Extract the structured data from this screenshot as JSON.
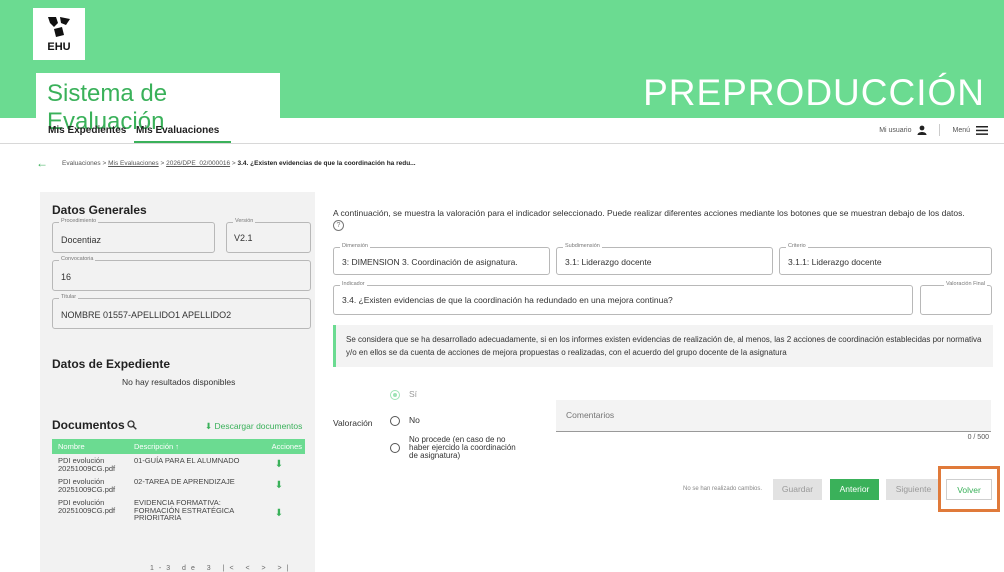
{
  "brand": {
    "logo_text": "EHU",
    "app_title": "Sistema de Evaluación",
    "environment": "PREPRODUCCIÓN"
  },
  "nav": {
    "tabs": [
      {
        "label": "Mis Expedientes"
      },
      {
        "label": "Mis Evaluaciones"
      }
    ],
    "user_label": "Mi usuario",
    "menu_label": "Menú"
  },
  "breadcrumb": {
    "root": "Evaluaciones",
    "separator": ">",
    "link1": "Mis Evaluaciones",
    "link2": "2026/DPE_02/000016",
    "current": "3.4. ¿Existen evidencias de que la coordinación ha redu..."
  },
  "general": {
    "title": "Datos Generales",
    "procedimiento": {
      "label": "Procedimiento",
      "value": "Docentiaz"
    },
    "version": {
      "label": "Versión",
      "value": "V2.1"
    },
    "convocatoria": {
      "label": "Convocatoria",
      "value": "16"
    },
    "titular": {
      "label": "Titular",
      "value": "NOMBRE 01557-APELLIDO1 APELLIDO2"
    }
  },
  "expediente": {
    "title": "Datos de Expediente",
    "empty_text": "No hay resultados disponibles"
  },
  "documents": {
    "title": "Documentos",
    "download_all": "Descargar documentos",
    "columns": [
      "Nombre",
      "Descripción ↑",
      "Acciones"
    ],
    "rows": [
      {
        "name": "PDI evolución 20251009CG.pdf",
        "description": "01-GUÍA PARA EL ALUMNADO"
      },
      {
        "name": "PDI evolución 20251009CG.pdf",
        "description": "02-TAREA DE APRENDIZAJE"
      },
      {
        "name": "PDI evolución 20251009CG.pdf",
        "description": "EVIDENCIA FORMATIVA: FORMACIÓN ESTRATÉGICA PRIORITARIA"
      }
    ],
    "pager": "1-3 de 3  |<  <  >  >|"
  },
  "intro_text": "A continuación, se muestra la valoración para el indicador seleccionado. Puede realizar diferentes acciones mediante los botones que se muestran debajo de los datos.",
  "indicator": {
    "dimension": {
      "label": "Dimensión",
      "value": "3: DIMENSION 3. Coordinación de asignatura."
    },
    "subdimension": {
      "label": "Subdimensión",
      "value": "3.1: Liderazgo docente"
    },
    "criterio": {
      "label": "Criterio",
      "value": "3.1.1: Liderazgo docente"
    },
    "indicador": {
      "label": "Indicador",
      "value": "3.4. ¿Existen evidencias de que la coordinación ha redundado en una mejora continua?"
    },
    "valoracion_final": {
      "label": "Valoración Final",
      "value": ""
    }
  },
  "callout_text": "Se considera que se ha desarrollado adecuadamente, si en los informes existen evidencias de realización de, al menos, las 2 acciones de coordinación establecidas por normativa y/o en ellos se da cuenta de acciones de mejora propuestas o realizadas, con el acuerdo del grupo docente de la asignatura",
  "valoracion": {
    "label": "Valoración",
    "options": [
      {
        "label": "Sí",
        "selected": true
      },
      {
        "label": "No",
        "selected": false
      },
      {
        "label": "No procede (en caso de no haber ejercido la coordinación de asignatura)",
        "selected": false
      }
    ]
  },
  "comments": {
    "placeholder": "Comentarios",
    "counter": "0 / 500"
  },
  "actions": {
    "status": "No se han realizado cambios.",
    "guardar": "Guardar",
    "anterior": "Anterior",
    "siguiente": "Siguiente",
    "volver": "Volver"
  },
  "colors": {
    "brand_green": "#6bdb91",
    "accent_green": "#3ab15a",
    "highlight": "#e07a3a"
  }
}
